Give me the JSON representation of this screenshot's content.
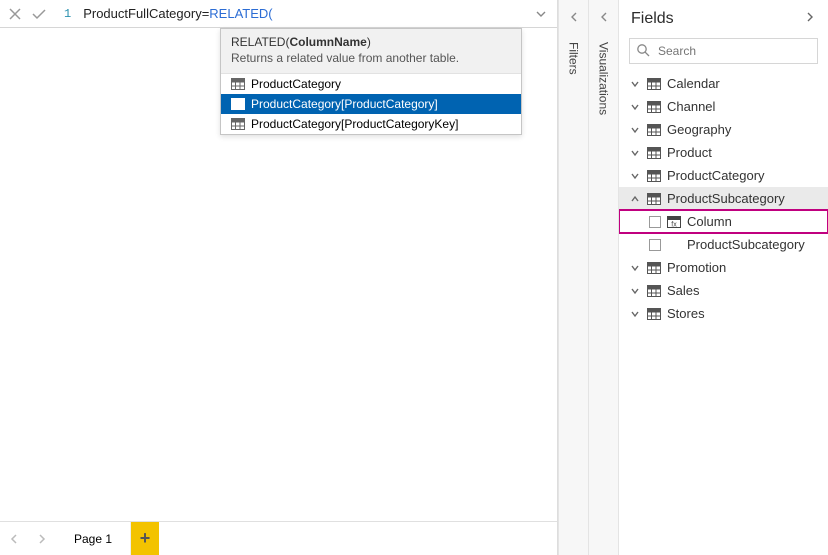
{
  "formula": {
    "line_no": "1",
    "plain": "ProductFullCategory=",
    "func": "RELATED(",
    "tooltip": {
      "fn": "RELATED",
      "arg": "ColumnName",
      "desc": "Returns a related value from another table.",
      "options": [
        {
          "label": "ProductCategory",
          "selected": false
        },
        {
          "label": "ProductCategory[ProductCategory]",
          "selected": true
        },
        {
          "label": "ProductCategory[ProductCategoryKey]",
          "selected": false
        }
      ]
    }
  },
  "rails": {
    "filters": "Filters",
    "visualizations": "Visualizations"
  },
  "fields": {
    "title": "Fields",
    "search_placeholder": "Search",
    "tables": [
      {
        "name": "Calendar",
        "expanded": false
      },
      {
        "name": "Channel",
        "expanded": false
      },
      {
        "name": "Geography",
        "expanded": false
      },
      {
        "name": "Product",
        "expanded": false
      },
      {
        "name": "ProductCategory",
        "expanded": false
      },
      {
        "name": "ProductSubcategory",
        "expanded": true,
        "fields": [
          {
            "name": "Column",
            "icon": "calc",
            "highlighted": true
          },
          {
            "name": "ProductSubcategory",
            "icon": "none",
            "highlighted": false
          }
        ]
      },
      {
        "name": "Promotion",
        "expanded": false
      },
      {
        "name": "Sales",
        "expanded": false
      },
      {
        "name": "Stores",
        "expanded": false
      }
    ]
  },
  "pages": {
    "active": "Page 1"
  }
}
